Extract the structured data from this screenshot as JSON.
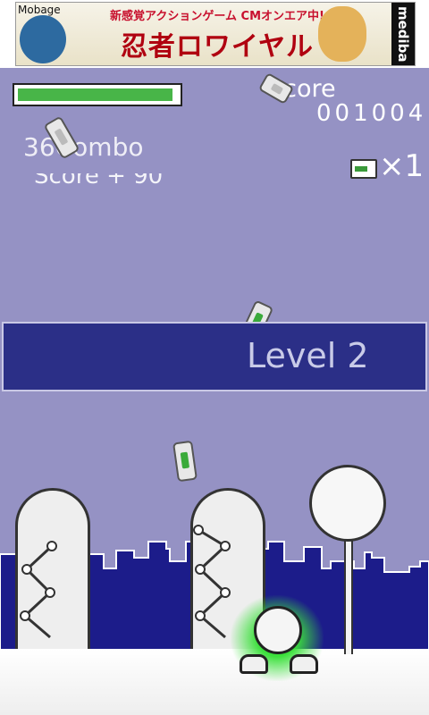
{
  "ad_banner": {
    "mobage_label": "Mobage",
    "tagline": "新感覚アクションゲーム CMオンエア中!",
    "title": "忍者ロワイヤル",
    "brand": "mediba"
  },
  "hud": {
    "score_label": "Score",
    "score_value": "001004",
    "combo_text": "36Combo",
    "score_popup": "Score + 90",
    "multiplier_text": "×1",
    "health_percent": 0.97
  },
  "level_banner": {
    "text": "Level 2"
  },
  "colors": {
    "sky": "#9592c4",
    "banner": "#2b2f87",
    "skyline": "#1c1c8a",
    "health": "#48b548",
    "glow": "#3ce03c"
  },
  "icons": {
    "battery": "battery-icon",
    "multiplier": "battery-card-icon",
    "player": "robot-icon"
  }
}
